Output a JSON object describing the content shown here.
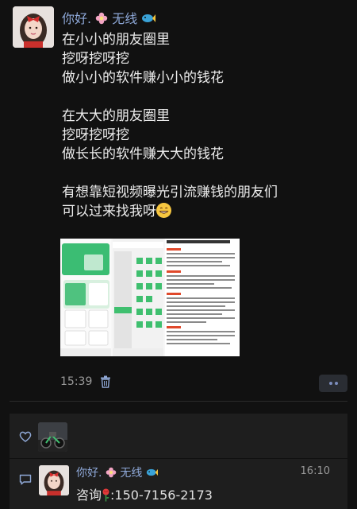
{
  "post": {
    "author": "你好.",
    "author_suffix": "无线",
    "lines": [
      "在小小的朋友圈里",
      "挖呀挖呀挖",
      "做小小的软件赚小小的钱花",
      "",
      "在大大的朋友圈里",
      "挖呀挖呀挖",
      "做长长的软件赚大大的钱花",
      "",
      "有想靠短视频曝光引流赚钱的朋友们",
      "可以过来找我呀"
    ],
    "time": "15:39",
    "thumbnail": {
      "header_text": "V3.1608.0000 2022年3月14日上线",
      "panel_title": "全不完更看"
    }
  },
  "comments": [
    {
      "author": "你好.",
      "author_suffix": "无线",
      "time": "16:10",
      "text_prefix": "咨询",
      "text_suffix": ":150-7156-2173"
    }
  ],
  "colors": {
    "background": "#111111",
    "name_link": "#8ea8d8",
    "panel": "#1e1e1e",
    "accent_green": "#3fbf6f"
  },
  "icons": [
    "flower-icon",
    "fish-icon",
    "grin-emoji-icon",
    "trash-icon",
    "more-dots-icon",
    "heart-icon",
    "comment-icon",
    "rose-icon"
  ]
}
